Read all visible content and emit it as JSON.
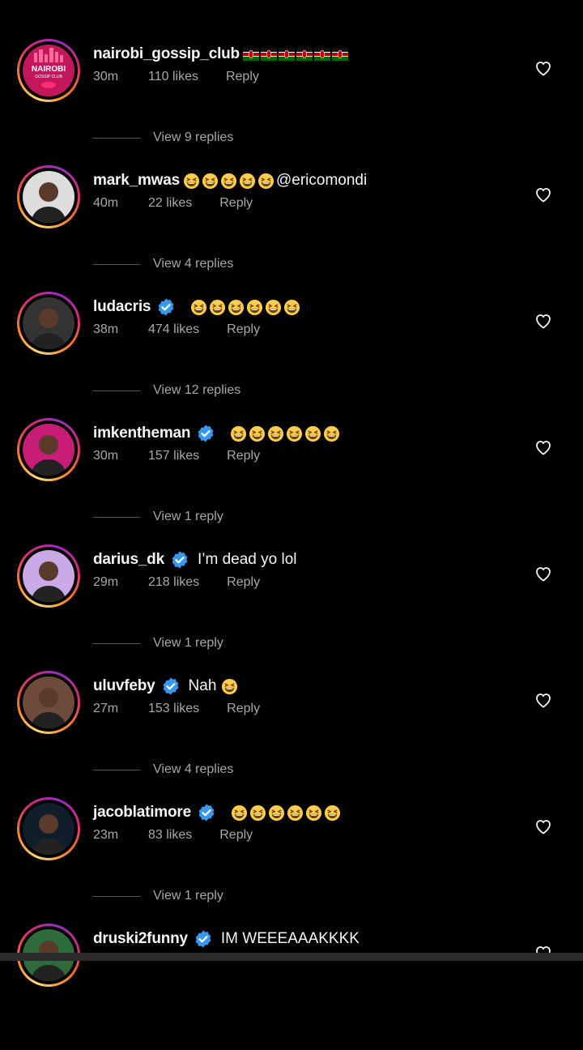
{
  "colors": {
    "verified": "#3897f0",
    "secondary_text": "#a8a8a8",
    "background": "#000000"
  },
  "comments": [
    {
      "username": "nairobi_gossip_club",
      "verified": false,
      "text": "",
      "prefix_flags": 6,
      "emoji_count": 0,
      "avatar_text": "NAIROBI",
      "avatar_subtext": "GOSSIP CLUB",
      "age": "30m",
      "likes": "110 likes",
      "reply": "Reply",
      "view_replies": "View 9 replies"
    },
    {
      "username": "mark_mwas",
      "verified": false,
      "text": "@ericomondi",
      "emoji_count": 5,
      "age": "40m",
      "likes": "22 likes",
      "reply": "Reply",
      "view_replies": "View 4 replies"
    },
    {
      "username": "ludacris",
      "verified": true,
      "text": "",
      "emoji_count": 6,
      "age": "38m",
      "likes": "474 likes",
      "reply": "Reply",
      "view_replies": "View 12 replies"
    },
    {
      "username": "imkentheman",
      "verified": true,
      "text": "",
      "emoji_count": 6,
      "age": "30m",
      "likes": "157 likes",
      "reply": "Reply",
      "view_replies": "View 1 reply"
    },
    {
      "username": "darius_dk",
      "verified": true,
      "text": "I’m dead yo lol",
      "emoji_count": 0,
      "age": "29m",
      "likes": "218 likes",
      "reply": "Reply",
      "view_replies": "View 1 reply"
    },
    {
      "username": "uluvfeby",
      "verified": true,
      "text": "Nah",
      "emoji_count": 1,
      "age": "27m",
      "likes": "153 likes",
      "reply": "Reply",
      "view_replies": "View 4 replies"
    },
    {
      "username": "jacoblatimore",
      "verified": true,
      "text": "",
      "emoji_count": 6,
      "age": "23m",
      "likes": "83 likes",
      "reply": "Reply",
      "view_replies": "View 1 reply"
    },
    {
      "username": "druski2funny",
      "verified": true,
      "text": "IM WEEEAAAKKKK",
      "emoji_count": 0,
      "age": "",
      "likes": "",
      "reply": "",
      "view_replies": ""
    }
  ],
  "icons": {
    "like": "heart-icon",
    "verified": "verified-badge-icon",
    "emoji": "grinning-squinting-face-emoji",
    "flag": "kenya-flag-emoji"
  }
}
